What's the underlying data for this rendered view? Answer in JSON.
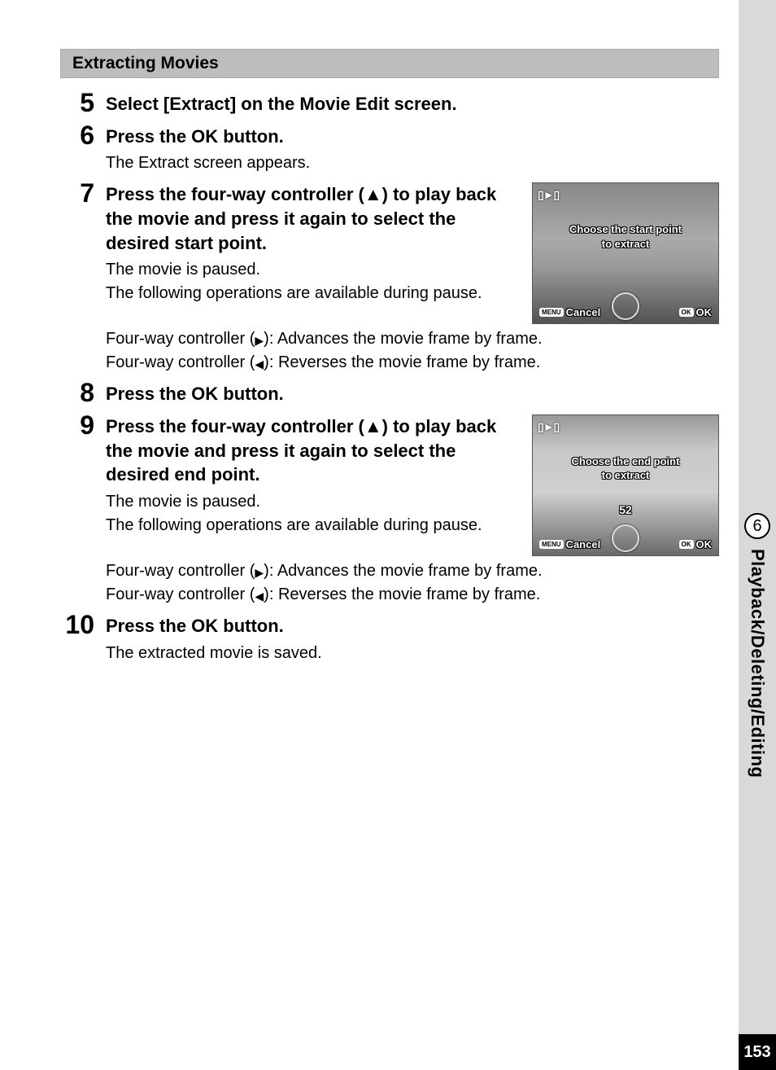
{
  "section_title": "Extracting Movies",
  "chapter_number": "6",
  "chapter_title": "Playback/Deleting/Editing",
  "page_number": "153",
  "screen1": {
    "icon": "▯►▯",
    "center_line1": "Choose the start point",
    "center_line2": "to extract",
    "menu_tag": "MENU",
    "cancel": "Cancel",
    "ok_tag": "OK",
    "ok": "OK"
  },
  "screen2": {
    "icon": "▯►▯",
    "center_line1": "Choose the end point",
    "center_line2": "to extract",
    "counter": "52",
    "menu_tag": "MENU",
    "cancel": "Cancel",
    "ok_tag": "OK",
    "ok": "OK"
  },
  "steps": {
    "s5": {
      "num": "5",
      "head": "Select [Extract] on the Movie Edit screen."
    },
    "s6": {
      "num": "6",
      "head": "Press the OK button.",
      "desc": "The Extract screen appears."
    },
    "s7": {
      "num": "7",
      "head": "Press the four-way controller (▲) to play back the movie and press it again to select the desired start point.",
      "p1": "The movie is paused.",
      "p2": "The following operations are available during pause.",
      "p3_a": "Four-way controller (",
      "p3_b": "): Advances the movie frame by frame.",
      "p4_a": "Four-way controller (",
      "p4_b": "): Reverses the movie frame by frame."
    },
    "s8": {
      "num": "8",
      "head": "Press the OK button."
    },
    "s9": {
      "num": "9",
      "head": "Press the four-way controller (▲) to play back the movie and press it again to select the desired end point.",
      "p1": "The movie is paused.",
      "p2": "The following operations are available during pause.",
      "p3_a": "Four-way controller (",
      "p3_b": "): Advances the movie frame by frame.",
      "p4_a": "Four-way controller (",
      "p4_b": "): Reverses the movie frame by frame."
    },
    "s10": {
      "num": "10",
      "head": "Press the OK button.",
      "desc": "The extracted movie is saved."
    }
  },
  "glyphs": {
    "right": "▶",
    "left": "◀",
    "up": "▲"
  }
}
